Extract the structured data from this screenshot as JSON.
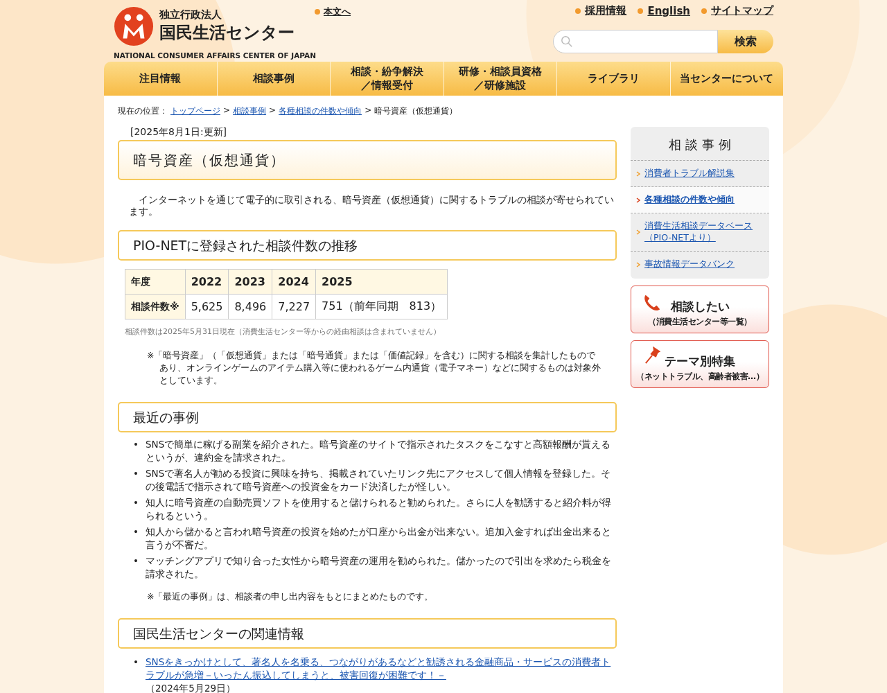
{
  "header": {
    "logo_subtitle": "独立行政法人",
    "logo_title": "国民生活センター",
    "logo_english": "NATIONAL CONSUMER AFFAIRS CENTER OF JAPAN",
    "skip_link": "本文へ",
    "top_links": [
      "採用情報",
      "English",
      "サイトマップ"
    ],
    "search": {
      "button": "検索"
    }
  },
  "nav": [
    {
      "lines": [
        "注目情報"
      ]
    },
    {
      "lines": [
        "相談事例"
      ]
    },
    {
      "lines": [
        "相談・紛争解決",
        "／情報受付"
      ]
    },
    {
      "lines": [
        "研修・相談員資格",
        "／研修施設"
      ]
    },
    {
      "lines": [
        "ライブラリ"
      ]
    },
    {
      "lines": [
        "当センターについて"
      ]
    }
  ],
  "breadcrumb": [
    {
      "kind": "text",
      "text": "現在の位置："
    },
    {
      "kind": "link",
      "text": "トップページ"
    },
    {
      "kind": "sep",
      "text": ">"
    },
    {
      "kind": "link",
      "text": "相談事例"
    },
    {
      "kind": "sep",
      "text": ">"
    },
    {
      "kind": "link",
      "text": "各種相談の件数や傾向"
    },
    {
      "kind": "sep",
      "text": ">"
    },
    {
      "kind": "text",
      "text": "暗号資産（仮想通貨）"
    }
  ],
  "updated": "[2025年8月1日:更新]",
  "title": "暗号資産（仮想通貨）",
  "intro": "インターネットを通じて電子的に取引される、暗号資産（仮想通貨）に関するトラブルの相談が寄せられています。",
  "stats": {
    "heading": "PIO-NETに登録された相談件数の推移",
    "table": {
      "header": [
        "年度",
        "2022",
        "2023",
        "2024",
        "2025"
      ],
      "rows": [
        [
          "相談件数※",
          "5,625",
          "8,496",
          "7,227",
          "751（前年同期　813）"
        ]
      ]
    },
    "caption": "相談件数は2025年5月31日現在（消費生活センター等からの経由相談は含まれていません）",
    "note": "※「暗号資産」（「仮想通貨」または「暗号通貨」または「価値記録」を含む）に関する相談を集計したものであり、オンラインゲームのアイテム購入等に使われるゲーム内通貨（電子マネー）などに関するものは対象外としています。"
  },
  "cases": {
    "heading": "最近の事例",
    "bullet": "•",
    "items": [
      "SNSで簡単に稼げる副業を紹介された。暗号資産のサイトで指示されたタスクをこなすと高額報酬が貰えるというが、違約金を請求された。",
      "SNSで著名人が勧める投資に興味を持ち、掲載されていたリンク先にアクセスして個人情報を登録した。その後電話で指示されて暗号資産への投資金をカード決済したが怪しい。",
      "知人に暗号資産の自動売買ソフトを使用すると儲けられると勧められた。さらに人を勧誘すると紹介料が得られるという。",
      "知人から儲かると言われ暗号資産の投資を始めたが口座から出金が出来ない。追加入金すれば出金出来ると言うが不審だ。",
      "マッチングアプリで知り合った女性から暗号資産の運用を勧められた。儲かったので引出を求めたら税金を請求された。"
    ],
    "note": "※「最近の事例」は、相談者の申し出内容をもとにまとめたものです。"
  },
  "related": {
    "heading": "国民生活センターの関連情報",
    "bullet": "•",
    "items": [
      {
        "link": "SNSをきっかけとして、著名人を名乗る、つながりがあるなどと勧誘される金融商品・サービスの消費者トラブルが急増－いったん振込してしまうと、被害回復が困難です！－",
        "date": "（2024年5月29日）"
      }
    ]
  },
  "sidebar": {
    "title": "相 談 事 例",
    "items": [
      {
        "lines": [
          "消費者トラブル解説集"
        ],
        "selected": false
      },
      {
        "lines": [
          "各種相談の件数や傾向"
        ],
        "selected": true
      },
      {
        "lines": [
          "消費生活相談データベース",
          "（PIO-NETより）"
        ],
        "selected": false
      },
      {
        "lines": [
          "事故情報データバンク"
        ],
        "selected": false
      }
    ],
    "cards": [
      {
        "kind": "phone",
        "title": "相談したい",
        "subtitle": "（消費生活センター等一覧）"
      },
      {
        "kind": "pin",
        "title": "テーマ別特集",
        "subtitle": "（ネットトラブル、高齢者被害…）"
      }
    ]
  }
}
